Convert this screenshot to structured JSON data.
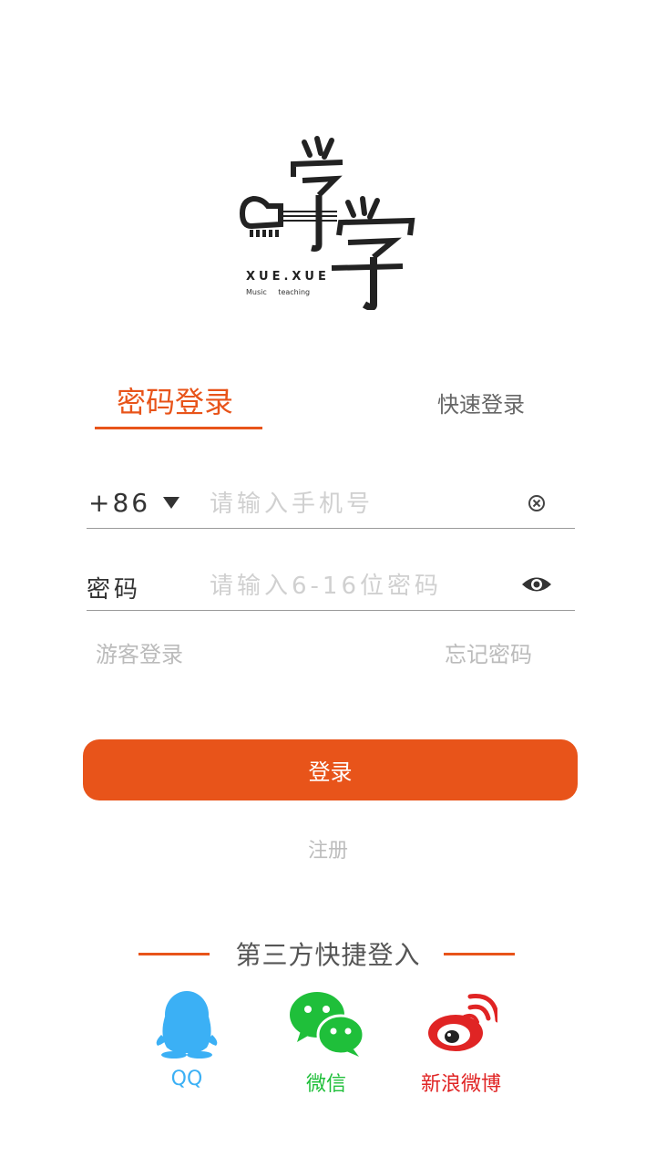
{
  "logo": {
    "wordmark": "XUE.XUE",
    "tagline": "Music teaching"
  },
  "tabs": {
    "password_login": "密码登录",
    "quick_login": "快速登录"
  },
  "phone": {
    "country_code": "+86",
    "placeholder": "请输入手机号"
  },
  "password": {
    "label": "密码",
    "placeholder": "请输入6-16位密码"
  },
  "links": {
    "guest_login": "游客登录",
    "forgot_password": "忘记密码"
  },
  "login_button": "登录",
  "register_link": "注册",
  "third_party": {
    "title": "第三方快捷登入",
    "items": [
      {
        "label": "QQ",
        "icon": "qq-icon",
        "color": "#3bb0f5"
      },
      {
        "label": "微信",
        "icon": "wechat-icon",
        "color": "#1fbf3a"
      },
      {
        "label": "新浪微博",
        "icon": "weibo-icon",
        "color": "#e02424"
      }
    ]
  },
  "colors": {
    "accent": "#e8541a"
  }
}
